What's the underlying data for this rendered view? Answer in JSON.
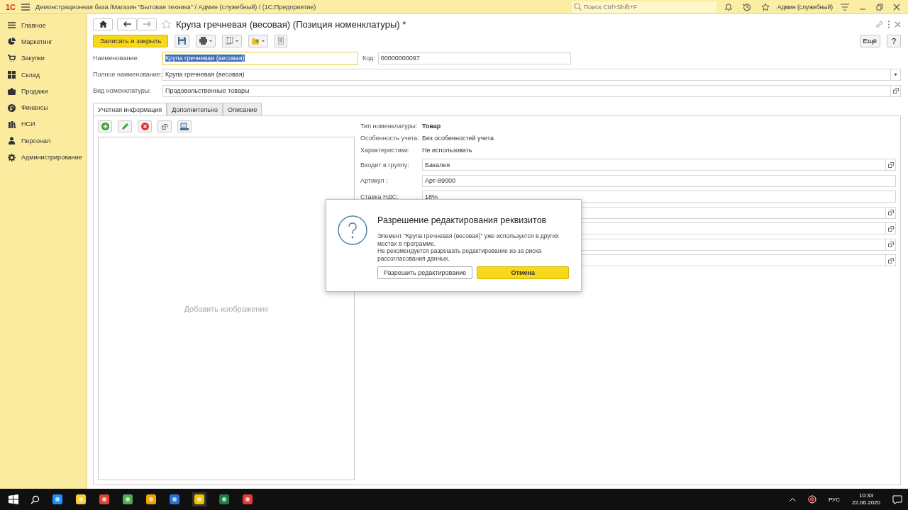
{
  "app_bar": {
    "logo": "1С",
    "title": "Демонстрационная база /Магазин \"Бытовая техника\" / Админ (служебный) /  (1С:Предприятие)",
    "search": {
      "placeholder": "Поиск Ctrl+Shift+F"
    },
    "user": "Админ (служебный)"
  },
  "sidebar": {
    "items": [
      {
        "label": "Главное",
        "selected": false
      },
      {
        "label": "Маркетинг",
        "selected": false
      },
      {
        "label": "Закупки",
        "selected": false
      },
      {
        "label": "Склад",
        "selected": false
      },
      {
        "label": "Продажи",
        "selected": false
      },
      {
        "label": "Финансы",
        "selected": false
      },
      {
        "label": "НСИ",
        "selected": false
      },
      {
        "label": "Персонал",
        "selected": false
      },
      {
        "label": "Администрирование",
        "selected": false
      }
    ]
  },
  "form": {
    "title": "Крупа гречневая (весовая) (Позиция номенклатуры) *",
    "favorite": false,
    "toolbar": {
      "save_close": "Записать и закрыть",
      "more": "Ещё",
      "help": "?"
    },
    "fields": {
      "name": {
        "label": "Наименование:",
        "value": "Крупа гречневая (весовая)"
      },
      "code": {
        "label": "Код:",
        "value": "00000000097"
      },
      "full_name": {
        "label": "Полное наименование:",
        "value": "Крупа гречневая (весовая)"
      },
      "kind": {
        "label": "Вид номенклатуры:",
        "value": "Продовольственные товары"
      }
    },
    "tabs": [
      {
        "label": "Учетная информация",
        "selected": true
      },
      {
        "label": "Дополнительно",
        "selected": false
      },
      {
        "label": "Описание",
        "selected": false
      }
    ],
    "image_placeholder": "Добавить изображение",
    "details": [
      {
        "kind": "info",
        "label": "Тип номенклатуры:",
        "value": "Товар",
        "bold": true
      },
      {
        "kind": "info",
        "label": "Особенность учета:",
        "value": "Без особенностей учета",
        "bold": false
      },
      {
        "kind": "info",
        "label": "Характеристики:",
        "value": "Не использовать",
        "bold": false
      },
      {
        "kind": "field",
        "label": "Входит в группу:",
        "value": "Бакалея",
        "open_button": true
      },
      {
        "kind": "field",
        "label": "Артикул :",
        "value": "Арт-89000",
        "open_button": false
      },
      {
        "kind": "field",
        "label": "Ставка НДС:",
        "value": "18%",
        "open_button": false
      },
      {
        "kind": "field",
        "open_button": true
      },
      {
        "kind": "field",
        "open_button": true
      },
      {
        "kind": "field",
        "open_button": true
      },
      {
        "kind": "field",
        "open_button": true
      }
    ]
  },
  "dialog": {
    "title": "Разрешение редактирования реквизитов",
    "message": "Элемент \"Крупа гречневая (весовая)\" уже используется в других местах в программе.\nНе рекомендуется разрешать редактирование из-за риска рассогласования данных.",
    "buttons": [
      {
        "label": "Разрешить редактирование",
        "default": false
      },
      {
        "label": "Отмена",
        "default": true
      }
    ]
  },
  "taskbar": {
    "language": "РУС",
    "time": "10:33",
    "date": "22.06.2020"
  }
}
